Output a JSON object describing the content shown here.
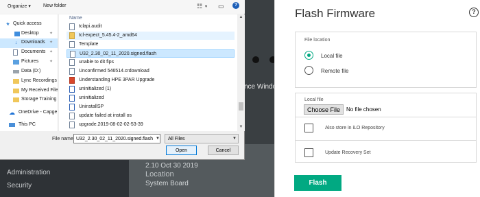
{
  "dialog": {
    "toolbar": {
      "organize": "Organize",
      "new_folder": "New folder"
    },
    "nav": [
      {
        "label": "Quick access",
        "icon": "star-icon",
        "selected": false,
        "pinned": false
      },
      {
        "label": "Desktop",
        "icon": "desktop-icon",
        "selected": false,
        "pinned": true
      },
      {
        "label": "Downloads",
        "icon": "download-icon",
        "selected": true,
        "pinned": true
      },
      {
        "label": "Documents",
        "icon": "documents-icon",
        "selected": false,
        "pinned": true
      },
      {
        "label": "Pictures",
        "icon": "pictures-icon",
        "selected": false,
        "pinned": true
      },
      {
        "label": "Data (D:)",
        "icon": "drive-icon",
        "selected": false,
        "pinned": false
      },
      {
        "label": "Lync Recordings",
        "icon": "folder-icon",
        "selected": false,
        "pinned": false
      },
      {
        "label": "My Received File",
        "icon": "folder-icon",
        "selected": false,
        "pinned": false
      },
      {
        "label": "Storage Training",
        "icon": "folder-icon",
        "selected": false,
        "pinned": false
      },
      {
        "label": "OneDrive - Capge",
        "icon": "onedrive-icon",
        "selected": false,
        "pinned": false
      },
      {
        "label": "This PC",
        "icon": "pc-icon",
        "selected": false,
        "pinned": false
      }
    ],
    "column_name": "Name",
    "files": [
      {
        "name": "tclapi.audit",
        "state": ""
      },
      {
        "name": "tcl-expect_5.45.4-2_amd64",
        "state": "hover"
      },
      {
        "name": "Template",
        "state": ""
      },
      {
        "name": "U32_2.30_02_11_2020.signed.flash",
        "state": "selected"
      },
      {
        "name": "unable to dit fips",
        "state": ""
      },
      {
        "name": "Unconfirmed 546514.crdownload",
        "state": ""
      },
      {
        "name": "Understanding HPE 3PAR Upgrade",
        "state": ""
      },
      {
        "name": "uninitialized (1)",
        "state": ""
      },
      {
        "name": "uninitialized",
        "state": ""
      },
      {
        "name": "UninstallSP",
        "state": ""
      },
      {
        "name": "update failed at install os",
        "state": ""
      },
      {
        "name": "upgrade.2019-08-02-02-53-39",
        "state": ""
      }
    ],
    "file_name_label": "File name:",
    "file_name_value": "U32_2.30_02_11_2020.signed.flash",
    "filter": "All Files",
    "open_label": "Open",
    "cancel_label": "Cancel"
  },
  "background": {
    "partial_text": "nce Windo",
    "version": "2.10 Oct 30 2019",
    "location_label": "Location",
    "location_value": "System Board",
    "nav": [
      "Administration",
      "Security"
    ]
  },
  "panel": {
    "title": "Flash Firmware",
    "file_location_label": "File location",
    "local_file": "Local file",
    "remote_file": "Remote file",
    "local_file_label": "Local file",
    "choose_file": "Choose File",
    "no_file": "No file chosen",
    "also_store": "Also store in iLO Repository",
    "update_recovery": "Update Recovery Set",
    "flash_label": "Flash",
    "accent_color": "#01a982"
  }
}
